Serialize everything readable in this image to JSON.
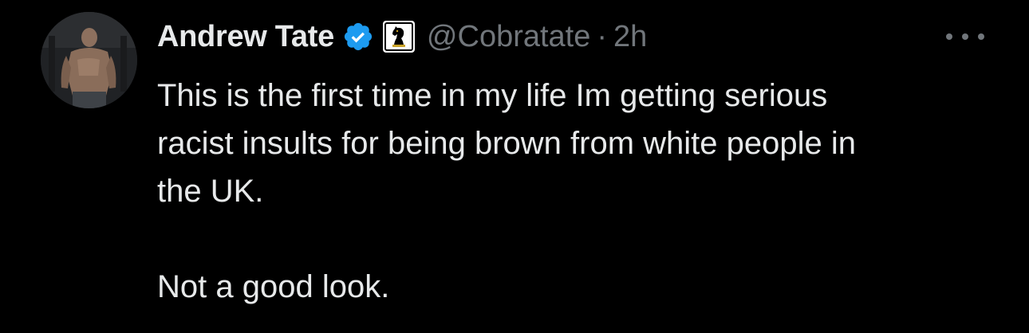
{
  "tweet": {
    "author": {
      "display_name": "Andrew Tate",
      "handle": "@Cobratate",
      "verified": true,
      "verified_icon": "verified-badge-icon",
      "affiliate_icon": "chess-knight-icon"
    },
    "separator": "·",
    "time": "2h",
    "more_icon": "more-options-icon",
    "text_lines": [
      "This is the first time in my life Im getting serious",
      "racist insults for being brown from white people in",
      "the UK."
    ],
    "text_last": "Not a good look."
  },
  "colors": {
    "background": "#000000",
    "primary_text": "#e7e9ea",
    "secondary_text": "#71767b",
    "verified_blue": "#1d9bf0"
  }
}
